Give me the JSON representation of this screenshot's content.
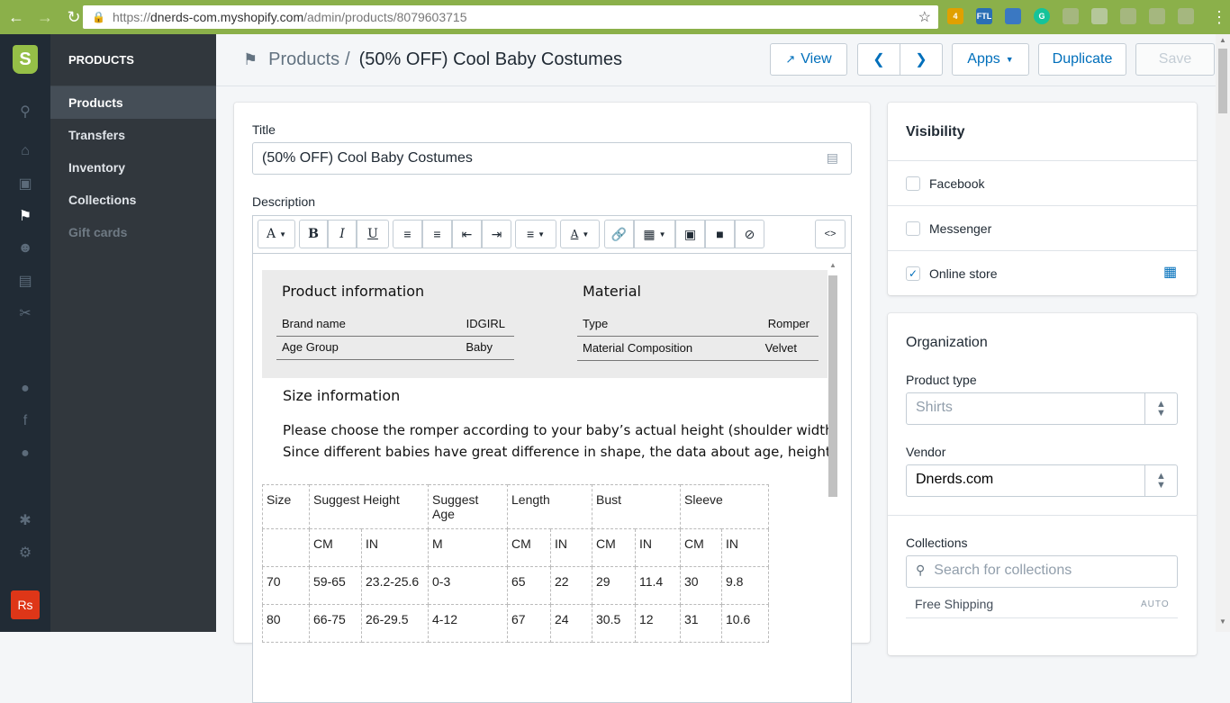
{
  "browser": {
    "url_base": "https://",
    "url_host": "dnerds-com.myshopify.com",
    "url_path": "/admin/products/8079603715",
    "ext_badge": "4",
    "ext_ftl": "FTL",
    "ext_g": "G"
  },
  "rail": {
    "logo": "S",
    "avatar": "Rs"
  },
  "subnav": {
    "heading": "PRODUCTS",
    "items": [
      {
        "label": "Products"
      },
      {
        "label": "Transfers"
      },
      {
        "label": "Inventory"
      },
      {
        "label": "Collections"
      },
      {
        "label": "Gift cards"
      }
    ]
  },
  "header": {
    "breadcrumb_parent": "Products",
    "breadcrumb_sep": "/",
    "page_title": "(50% OFF) Cool Baby Costumes",
    "view_label": "View",
    "apps_label": "Apps",
    "duplicate_label": "Duplicate",
    "save_label": "Save"
  },
  "product": {
    "title_label": "Title",
    "title_value": "(50% OFF) Cool Baby Costumes",
    "description_label": "Description"
  },
  "toolbar": {
    "font": "A",
    "bold": "B",
    "italic": "I",
    "underline": "U",
    "color": "A",
    "html": "<>"
  },
  "description": {
    "product_info_heading": "Product information",
    "material_heading": "Material",
    "info_rows": [
      {
        "key": "Brand name",
        "value": "IDGIRL"
      },
      {
        "key": "Age Group",
        "value": "Baby"
      }
    ],
    "material_rows": [
      {
        "key": "Type",
        "value": "Romper"
      },
      {
        "key": "Material Composition",
        "value": "Velvet"
      }
    ],
    "size_heading": "Size information",
    "line1": "Please choose the romper according to your baby’s actual height (shoulder width,",
    "line2": "Since different babies have great difference in shape, the data about age, height",
    "table": {
      "header": [
        "Size",
        "Suggest Height",
        "Suggest Age",
        "Length",
        "Bust",
        "Sleeve"
      ],
      "units": [
        "",
        "CM",
        "IN",
        "M",
        "CM",
        "IN",
        "CM",
        "IN",
        "CM",
        "IN"
      ],
      "rows": [
        [
          "70",
          "59-65",
          "23.2-25.6",
          "0-3",
          "65",
          "22",
          "29",
          "11.4",
          "30",
          "9.8"
        ],
        [
          "80",
          "66-75",
          "26-29.5",
          "4-12",
          "67",
          "24",
          "30.5",
          "12",
          "31",
          "10.6"
        ]
      ]
    }
  },
  "visibility": {
    "title": "Visibility",
    "channels": [
      {
        "label": "Facebook",
        "checked": false
      },
      {
        "label": "Messenger",
        "checked": false
      },
      {
        "label": "Online store",
        "checked": true
      }
    ]
  },
  "organization": {
    "title": "Organization",
    "product_type_label": "Product type",
    "product_type_placeholder": "Shirts",
    "vendor_label": "Vendor",
    "vendor_value": "Dnerds.com",
    "collections_label": "Collections",
    "collections_placeholder": "Search for collections",
    "collection_items": [
      {
        "label": "Free Shipping",
        "badge": "AUTO"
      }
    ]
  }
}
